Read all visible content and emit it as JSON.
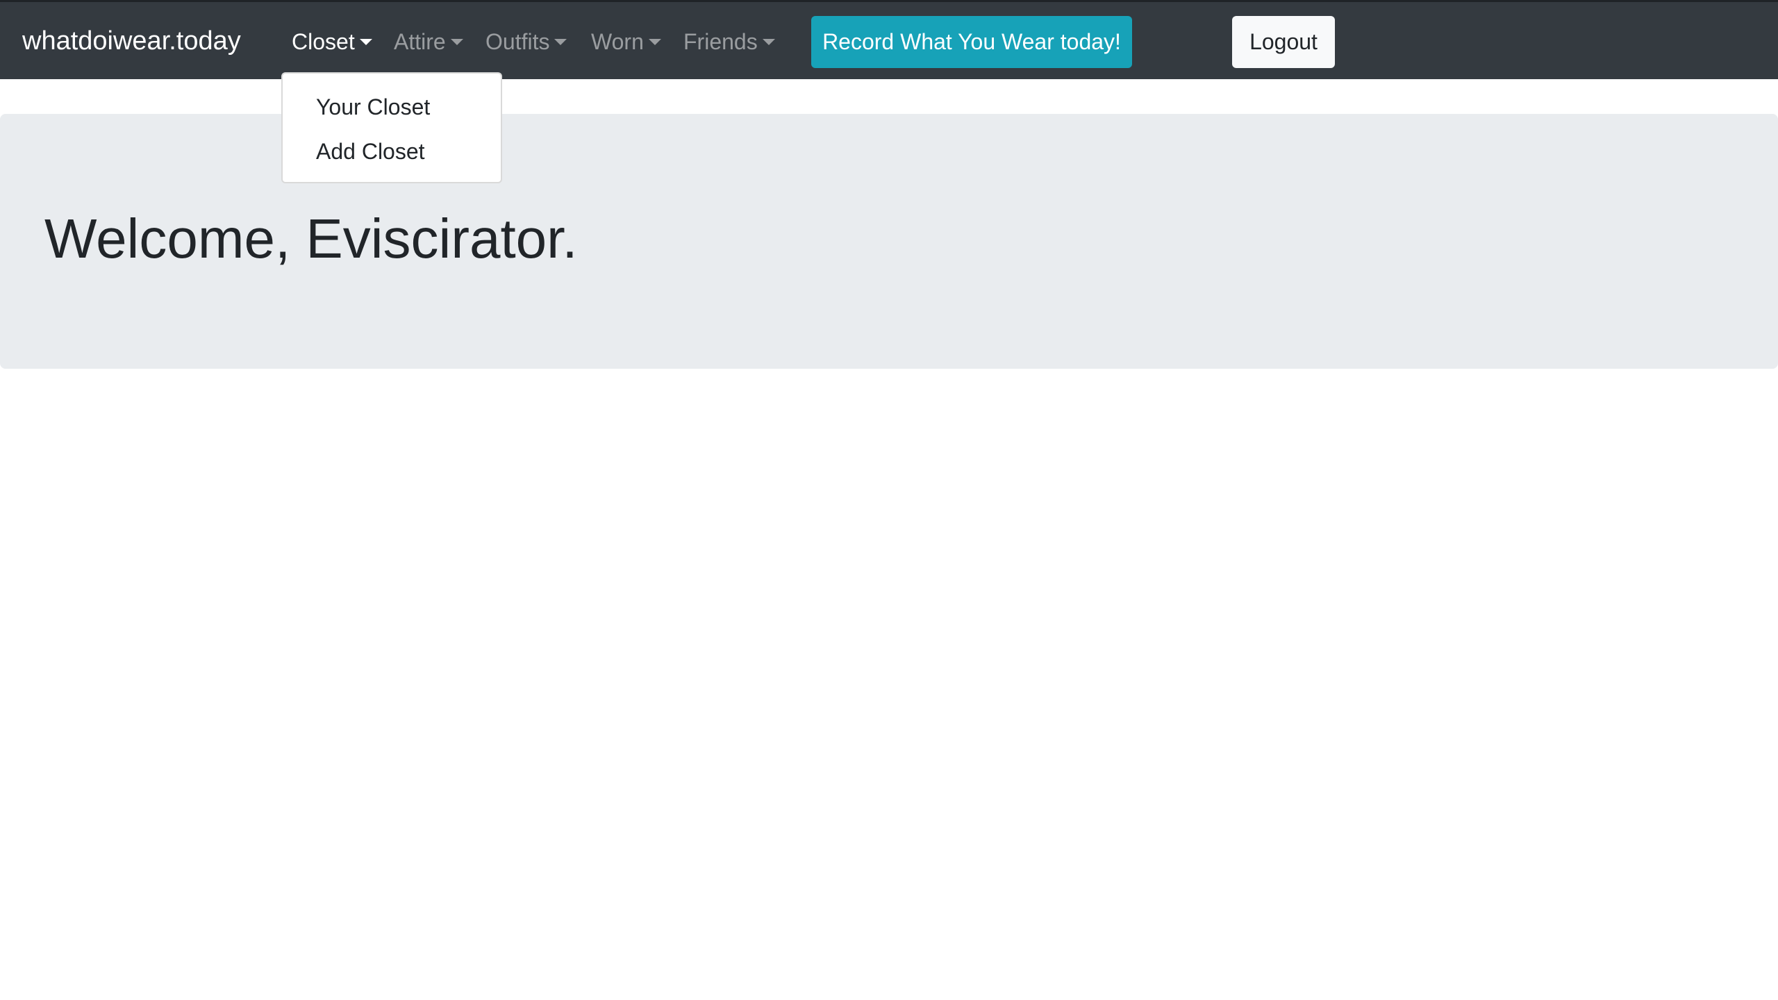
{
  "navbar": {
    "brand": "whatdoiwear.today",
    "items": [
      {
        "label": "Closet",
        "active": true
      },
      {
        "label": "Attire",
        "active": false
      },
      {
        "label": "Outfits",
        "active": false
      },
      {
        "label": "Worn",
        "active": false
      },
      {
        "label": "Friends",
        "active": false
      }
    ],
    "record_button": "Record What You Wear today!",
    "logout_button": "Logout"
  },
  "dropdown": {
    "items": [
      {
        "label": "Your Closet"
      },
      {
        "label": "Add Closet"
      }
    ]
  },
  "main": {
    "welcome": "Welcome, Eviscirator."
  },
  "colors": {
    "navbar_bg": "#343a40",
    "record_button_bg": "#17a2b8",
    "logout_button_bg": "#f8f9fa",
    "jumbotron_bg": "#e9ecef"
  }
}
